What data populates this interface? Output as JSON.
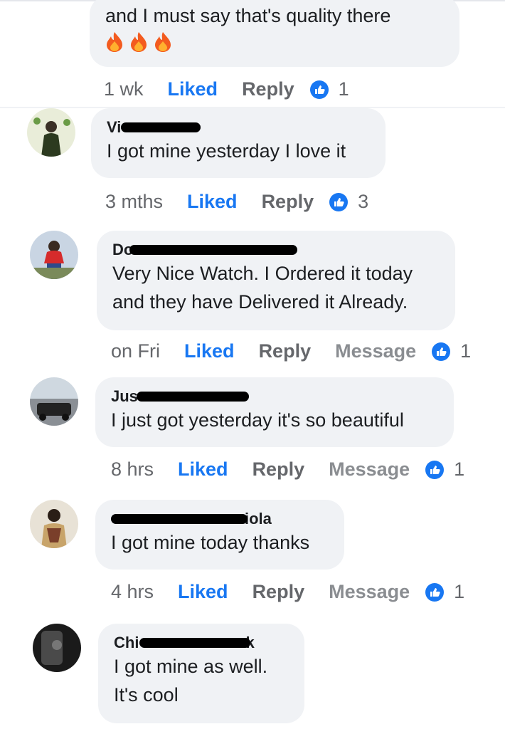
{
  "colors": {
    "accent": "#1877f2",
    "bubble": "#f0f2f5",
    "muted": "#65676b"
  },
  "comments": [
    {
      "text": "and I must say that's quality there",
      "emoji": [
        "fire-icon",
        "fire-icon",
        "fire-icon"
      ],
      "time": "1 wk",
      "liked": "Liked",
      "reply": "Reply",
      "reactions": "1"
    },
    {
      "name_visible": "Vi",
      "text": "I got mine yesterday I love it",
      "time": "3 mths",
      "liked": "Liked",
      "reply": "Reply",
      "reactions": "3"
    },
    {
      "name_visible": "Do",
      "text_line1": "Very Nice Watch. I Ordered it today",
      "text_line2": "and they have Delivered it Already.",
      "time": "on Fri",
      "liked": "Liked",
      "reply": "Reply",
      "message": "Message",
      "reactions": "1"
    },
    {
      "name_visible": "Jus",
      "text": "I just got yesterday it's so beautiful",
      "time": "8 hrs",
      "liked": "Liked",
      "reply": "Reply",
      "message": "Message",
      "reactions": "1"
    },
    {
      "name_visible_end": "iola",
      "text": "I got mine today thanks",
      "time": "4 hrs",
      "liked": "Liked",
      "reply": "Reply",
      "message": "Message",
      "reactions": "1"
    },
    {
      "name_visible": "Chi",
      "name_visible_end": "k",
      "text_line1": "I got mine as well.",
      "text_line2": "It's cool"
    }
  ]
}
